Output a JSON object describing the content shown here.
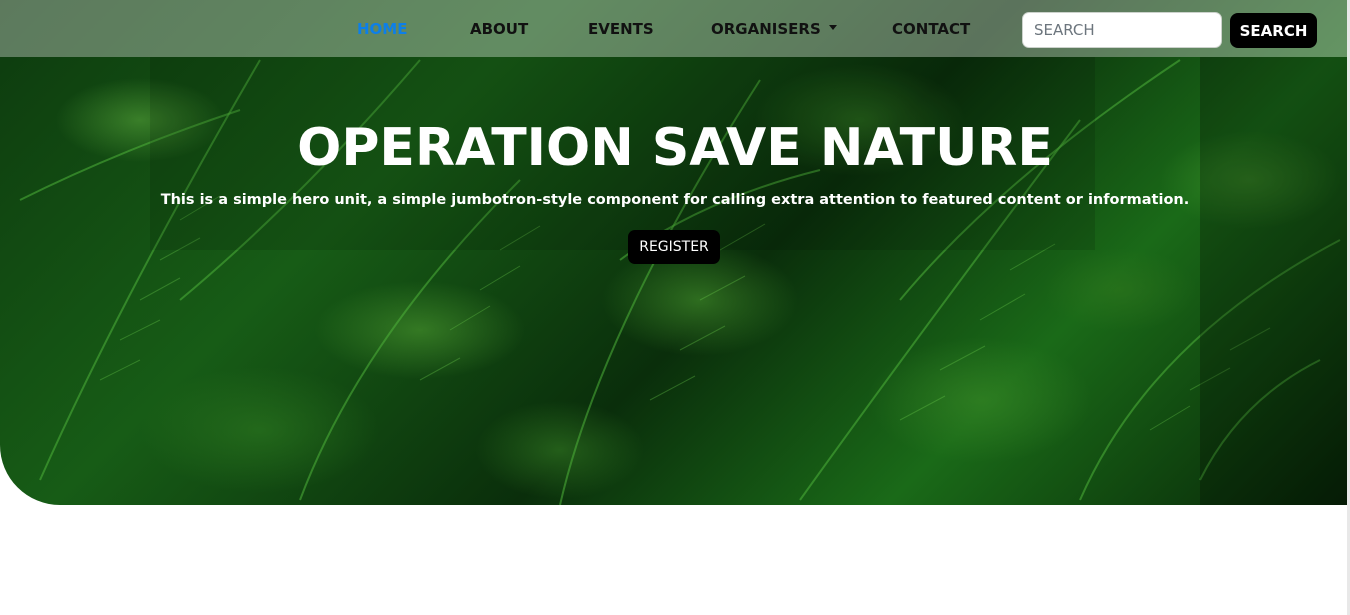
{
  "nav": {
    "items": [
      {
        "label": "HOME",
        "active": true
      },
      {
        "label": "ABOUT",
        "active": false
      },
      {
        "label": "EVENTS",
        "active": false
      },
      {
        "label": "ORGANISERS",
        "active": false,
        "dropdown": true
      },
      {
        "label": "CONTACT",
        "active": false
      }
    ],
    "search": {
      "placeholder": "SEARCH",
      "value": "",
      "button_label": "SEARCH"
    }
  },
  "hero": {
    "title": "OPERATION SAVE NATURE",
    "lead": "This is a simple hero unit, a simple jumbotron-style component for calling extra attention to featured content or information.",
    "button_label": "REGISTER",
    "background": "fern-foliage-image"
  },
  "colors": {
    "active_link": "#0d7fe8",
    "button_bg": "#000000",
    "foliage": "#1a6a18"
  },
  "icons": {
    "dropdown": "caret-down-icon"
  }
}
